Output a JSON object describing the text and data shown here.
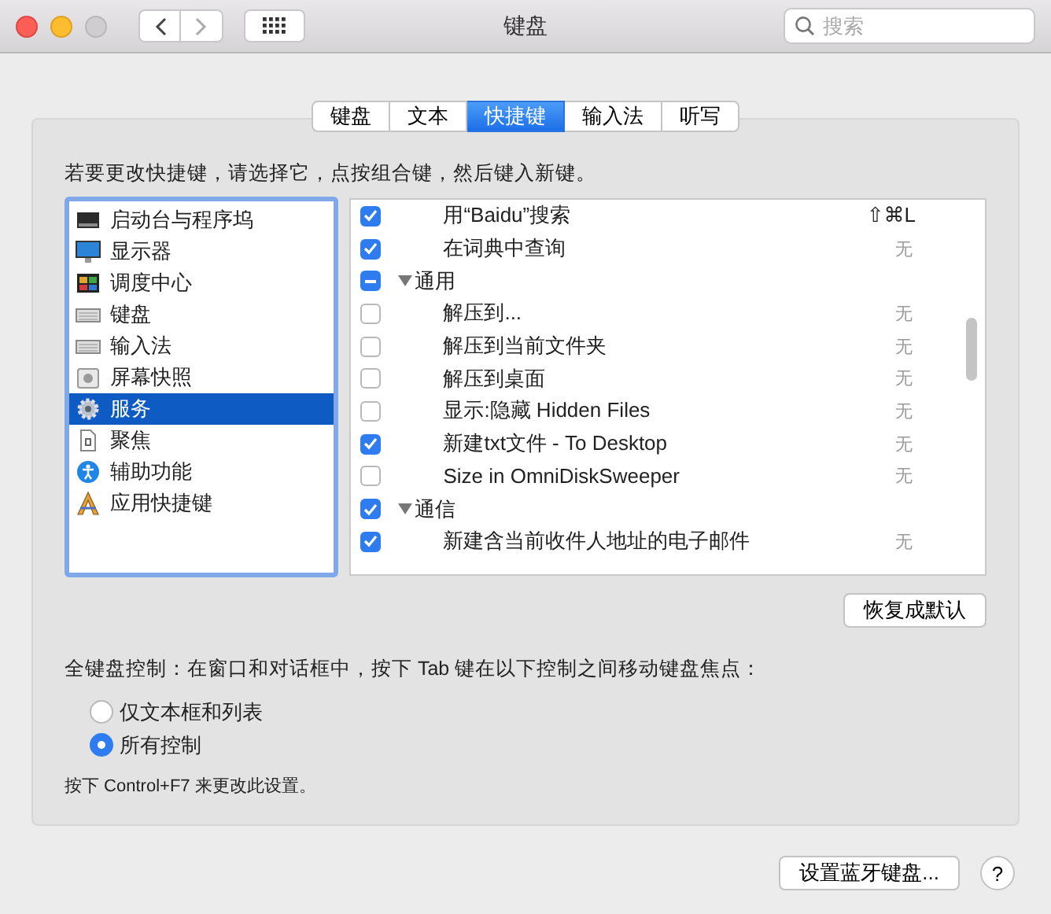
{
  "window": {
    "title": "键盘",
    "search": {
      "placeholder": "搜索"
    }
  },
  "tabs": [
    {
      "label": "键盘",
      "selected": false
    },
    {
      "label": "文本",
      "selected": false
    },
    {
      "label": "快捷键",
      "selected": true
    },
    {
      "label": "输入法",
      "selected": false
    },
    {
      "label": "听写",
      "selected": false
    }
  ],
  "instruction": "若要更改快捷键，请选择它，点按组合键，然后键入新键。",
  "categories": [
    {
      "label": "启动台与程序坞",
      "kind": "launchpad",
      "selected": false
    },
    {
      "label": "显示器",
      "kind": "display",
      "selected": false
    },
    {
      "label": "调度中心",
      "kind": "mission",
      "selected": false
    },
    {
      "label": "键盘",
      "kind": "keyboard",
      "selected": false
    },
    {
      "label": "输入法",
      "kind": "keyboard",
      "selected": false
    },
    {
      "label": "屏幕快照",
      "kind": "screenshot",
      "selected": false
    },
    {
      "label": "服务",
      "kind": "gear",
      "selected": true
    },
    {
      "label": "聚焦",
      "kind": "document",
      "selected": false
    },
    {
      "label": "辅助功能",
      "kind": "accessibility",
      "selected": false
    },
    {
      "label": "应用快捷键",
      "kind": "app",
      "selected": false
    }
  ],
  "shortcuts": [
    {
      "kind": "item",
      "label": "用“Baidu”搜索",
      "shortcut": "⇧⌘L",
      "checked": true,
      "mixed": false
    },
    {
      "kind": "item",
      "label": "在词典中查询",
      "shortcut": "无",
      "checked": true,
      "mixed": false
    },
    {
      "kind": "group",
      "label": "通用",
      "expanded": true,
      "checked": true,
      "mixed": true
    },
    {
      "kind": "item",
      "label": "解压到...",
      "shortcut": "无",
      "checked": false,
      "mixed": false
    },
    {
      "kind": "item",
      "label": "解压到当前文件夹",
      "shortcut": "无",
      "checked": false,
      "mixed": false
    },
    {
      "kind": "item",
      "label": "解压到桌面",
      "shortcut": "无",
      "checked": false,
      "mixed": false
    },
    {
      "kind": "item",
      "label": "显示:隐藏 Hidden Files",
      "shortcut": "无",
      "checked": false,
      "mixed": false
    },
    {
      "kind": "item",
      "label": "新建txt文件 - To Desktop",
      "shortcut": "无",
      "checked": true,
      "mixed": false
    },
    {
      "kind": "item",
      "label": "Size in OmniDiskSweeper",
      "shortcut": "无",
      "checked": false,
      "mixed": false
    },
    {
      "kind": "group",
      "label": "通信",
      "expanded": true,
      "checked": true,
      "mixed": false
    },
    {
      "kind": "item",
      "label": "新建含当前收件人地址的电子邮件",
      "shortcut": "无",
      "checked": true,
      "mixed": false
    }
  ],
  "restore_button": "恢复成默认",
  "full_keyboard": {
    "label": "全键盘控制：在窗口和对话框中，按下 Tab 键在以下控制之间移动键盘焦点：",
    "options": [
      {
        "label": "仅文本框和列表",
        "selected": false
      },
      {
        "label": "所有控制",
        "selected": true
      }
    ],
    "hint": "按下 Control+F7 来更改此设置。"
  },
  "bluetooth_button": "设置蓝牙键盘...",
  "help_button": "?"
}
